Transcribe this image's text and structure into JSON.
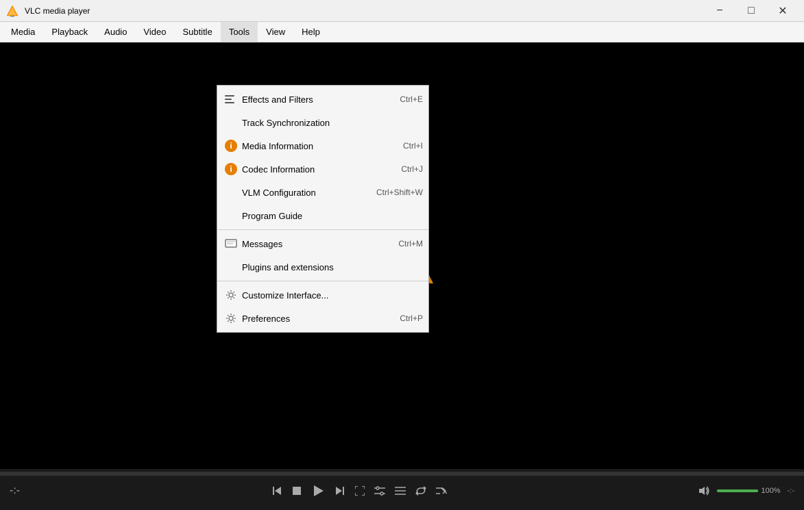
{
  "app": {
    "title": "VLC media player",
    "icon": "vlc-icon"
  },
  "titlebar": {
    "title": "VLC media player",
    "minimize_label": "−",
    "maximize_label": "□",
    "close_label": "✕"
  },
  "menubar": {
    "items": [
      {
        "id": "media",
        "label": "Media"
      },
      {
        "id": "playback",
        "label": "Playback"
      },
      {
        "id": "audio",
        "label": "Audio"
      },
      {
        "id": "video",
        "label": "Video"
      },
      {
        "id": "subtitle",
        "label": "Subtitle"
      },
      {
        "id": "tools",
        "label": "Tools"
      },
      {
        "id": "view",
        "label": "View"
      },
      {
        "id": "help",
        "label": "Help"
      }
    ]
  },
  "tools_menu": {
    "items": [
      {
        "id": "effects-filters",
        "label": "Effects and Filters",
        "shortcut": "Ctrl+E",
        "icon": "sliders-icon"
      },
      {
        "id": "track-sync",
        "label": "Track Synchronization",
        "shortcut": "",
        "icon": "none"
      },
      {
        "id": "media-info",
        "label": "Media Information",
        "shortcut": "Ctrl+I",
        "icon": "info-icon"
      },
      {
        "id": "codec-info",
        "label": "Codec Information",
        "shortcut": "Ctrl+J",
        "icon": "info-icon"
      },
      {
        "id": "vlm-config",
        "label": "VLM Configuration",
        "shortcut": "Ctrl+Shift+W",
        "icon": "none"
      },
      {
        "id": "program-guide",
        "label": "Program Guide",
        "shortcut": "",
        "icon": "none"
      },
      {
        "id": "separator1",
        "type": "separator"
      },
      {
        "id": "messages",
        "label": "Messages",
        "shortcut": "Ctrl+M",
        "icon": "messages-icon"
      },
      {
        "id": "plugins",
        "label": "Plugins and extensions",
        "shortcut": "",
        "icon": "none"
      },
      {
        "id": "separator2",
        "type": "separator"
      },
      {
        "id": "customize",
        "label": "Customize Interface...",
        "shortcut": "",
        "icon": "gear-icon"
      },
      {
        "id": "preferences",
        "label": "Preferences",
        "shortcut": "Ctrl+P",
        "icon": "gear-icon"
      }
    ]
  },
  "controls": {
    "time_left": "-:-",
    "time_right": "-:-",
    "volume_percent": "100%",
    "volume_level": 100
  }
}
